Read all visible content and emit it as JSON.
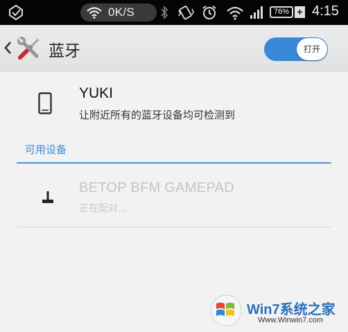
{
  "status_bar": {
    "network_speed": "0K/S",
    "battery_level": "76%",
    "battery_charging_symbol": "+",
    "time": "4:15",
    "icons": [
      "notification-icon",
      "wifi-icon",
      "bluetooth-icon",
      "vibrate-icon",
      "alarm-icon",
      "wifi-signal-icon",
      "cell-signal-icon",
      "battery-icon"
    ]
  },
  "action_bar": {
    "title": "蓝牙",
    "toggle_label": "打开",
    "toggle_state": "on",
    "accent_color": "#3a88d8"
  },
  "this_device": {
    "name": "YUKI",
    "subtitle": "让附近所有的蓝牙设备均可检测到"
  },
  "available_section": {
    "header": "可用设备",
    "devices": [
      {
        "name": "BETOP BFM GAMEPAD",
        "status": "正在配对..."
      }
    ]
  },
  "watermark": {
    "brand": "Win7系统之家",
    "url": "Www.Winwin7.com"
  }
}
